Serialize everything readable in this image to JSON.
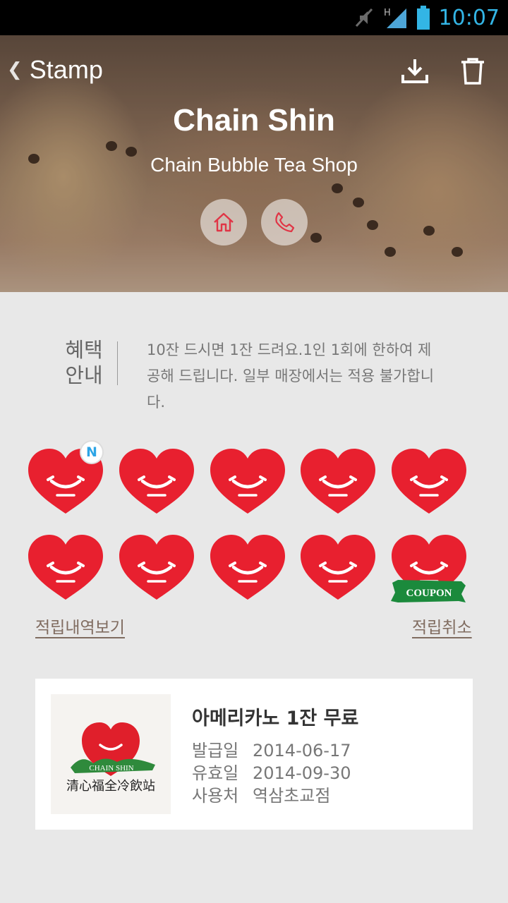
{
  "status_bar": {
    "time": "10:07",
    "network_label": "H"
  },
  "header": {
    "back_label": "Stamp",
    "title": "Chain Shin",
    "subtitle": "Chain Bubble Tea Shop",
    "icons": [
      "download-icon",
      "trash-icon",
      "home-icon",
      "phone-icon"
    ],
    "accent": "#e03546"
  },
  "benefit": {
    "title": "혜택 안내",
    "text": "10잔 드시면 1잔 드려요.1인 1회에 한하여 제공해 드립니다. 일부 매장에서는 적용 불가합니다."
  },
  "stamps": {
    "count": 10,
    "new_badge": "N",
    "coupon_label": "COUPON",
    "heart_color": "#e8202f",
    "ribbon_color": "#1b8a3c"
  },
  "links": {
    "history": "적립내역보기",
    "cancel": "적립취소"
  },
  "coupon": {
    "title": "아메리카노 1잔 무료",
    "rows": [
      {
        "key": "발급일",
        "value": "2014-06-17"
      },
      {
        "key": "유효일",
        "value": "2014-09-30"
      },
      {
        "key": "사용처",
        "value": "역삼초교점"
      }
    ],
    "logo_text": "CHAIN SHIN"
  }
}
